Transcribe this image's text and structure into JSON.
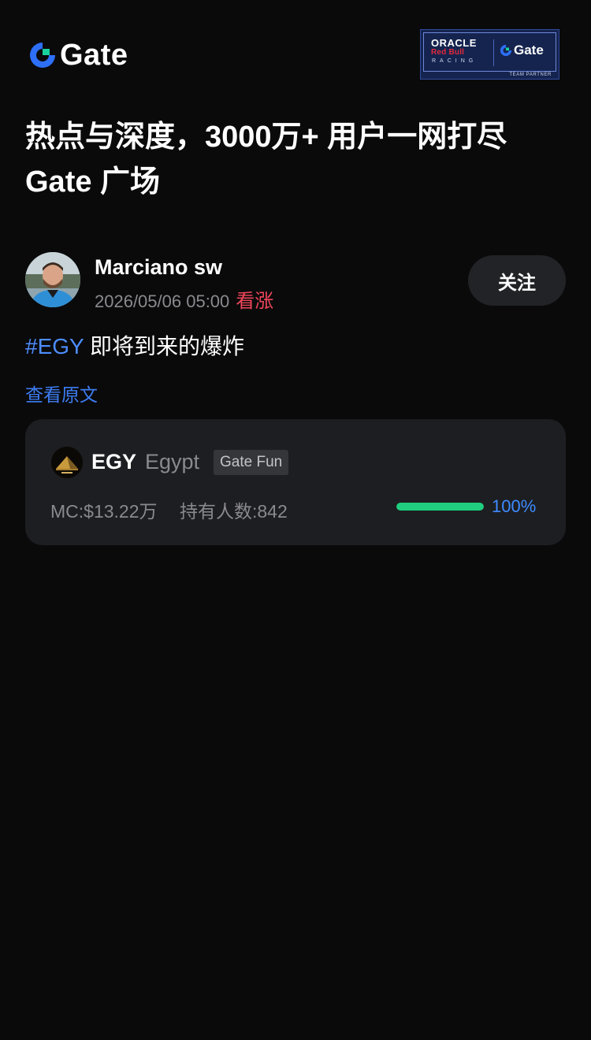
{
  "header": {
    "logo_text": "Gate",
    "partner_badge": {
      "line1": "ORACLE",
      "line2": "Red Bull",
      "line3": "RACING",
      "brand": "Gate",
      "footer": "TEAM PARTNER"
    }
  },
  "headline": {
    "line1": "热点与深度，3000万+ 用户一网打尽",
    "line2": "Gate 广场"
  },
  "post": {
    "author_name": "Marciano sw",
    "time": "2026/05/06 05:00",
    "sentiment": "看涨",
    "follow_label": "关注",
    "hashtag": "#EGY",
    "body_text": " 即将到来的爆炸",
    "view_original_label": "查看原文"
  },
  "token_card": {
    "symbol": "EGY",
    "name": "Egypt",
    "tag": "Gate Fun",
    "market_cap": "MC:$13.22万",
    "holders": "持有人数:842",
    "progress": 100,
    "progress_label": "100%"
  },
  "colors": {
    "background": "#0a0a0b",
    "accent_blue": "#3d7df2",
    "sentiment_red": "#f0475a",
    "progress_green": "#1fcf7f",
    "card_bg": "#1d1e21"
  }
}
